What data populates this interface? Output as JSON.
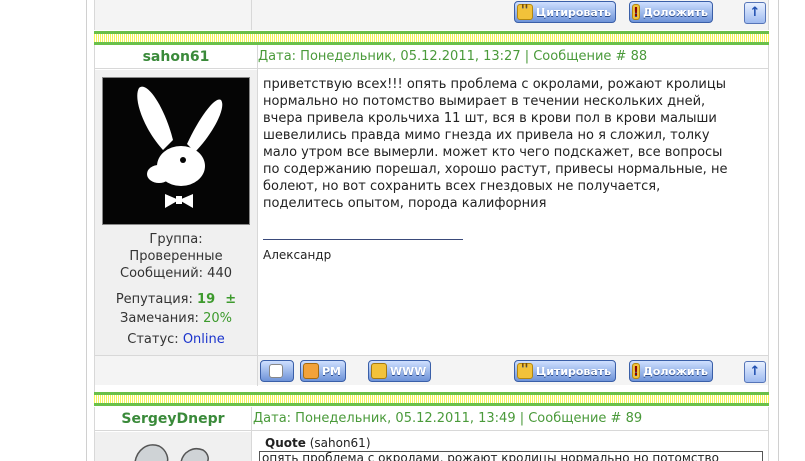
{
  "buttons": {
    "quote": "Цитировать",
    "report": "Доложить",
    "pm": "PM",
    "www": "WWW",
    "up": "↑"
  },
  "post1": {
    "nickname": "sahon61",
    "meta": "Дата: Понедельник, 05.12.2011, 13:27 | Сообщение # 88",
    "group_label": "Группа:",
    "group_value": "Проверенные",
    "messages_label": "Сообщений:",
    "messages_value": "440",
    "reputation_label": "Репутация:",
    "reputation_value": "19",
    "reputation_pm": "±",
    "remarks_label": "Замечания:",
    "remarks_value": "20%",
    "status_label": "Статус:",
    "status_value": "Online",
    "body_lines": [
      "приветствую всех!!! опять проблема с окролами, рожают кролицы",
      "нормально но потомство вымирает в течении нескольких дней,",
      "вчера привела крольчиха 11 шт, вся в крови пол в крови малыши",
      "шевелились правда мимо гнезда их привела но я сложил, толку",
      "мало утром все вымерли. может кто чего подскажет, все вопросы",
      "по содержанию порешал, хорошо растут, привесы нормальные, не",
      "болеют, но вот сохранить всех гнездовых не получается,",
      "поделитесь опытом, порода калифорния"
    ],
    "signature": "Александр"
  },
  "post2": {
    "nickname": "SergeyDnepr",
    "meta": "Дата: Понедельник, 05.12.2011, 13:49 | Сообщение # 89",
    "quote_label": "Quote",
    "quote_author": "(sahon61)",
    "quote_text": "опять проблема с окролами, рожают кролицы нормально но потомство"
  },
  "colors": {
    "accent_green": "#3d9a2d",
    "stripe_yellow": "#f5f55a",
    "link_blue": "#1a33cc"
  }
}
